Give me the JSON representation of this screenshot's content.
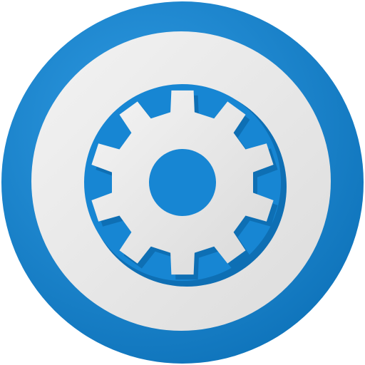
{
  "icon": {
    "name": "gear-icon",
    "palette": {
      "outer_ring": "#1a8ad6",
      "outer_ring_highlight": "#2f9be3",
      "outer_ring_shadow": "#0f74bb",
      "white_ring": "#f3f3f3",
      "white_ring_shade": "#dcdcdc",
      "inner_disc": "#1786d3",
      "inner_disc_shadow": "#0e6fb4",
      "gear": "#f4f4f4",
      "gear_shade": "#d9d9d9",
      "hub": "#1786d3"
    },
    "gear_teeth": 10
  }
}
